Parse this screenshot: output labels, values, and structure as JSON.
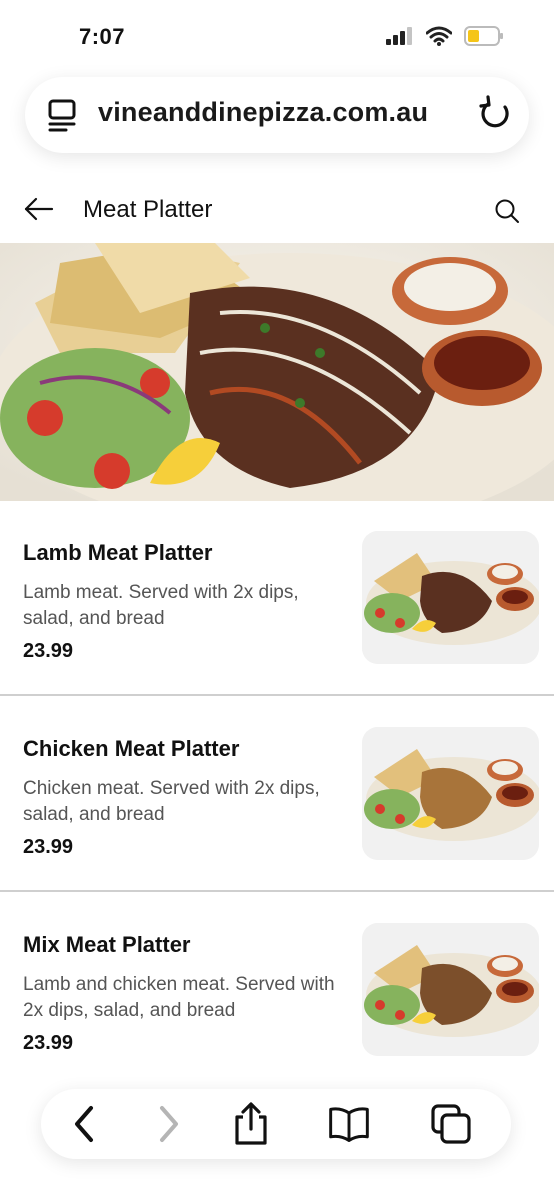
{
  "status": {
    "time": "7:07"
  },
  "browser": {
    "url": "vineanddinepizza.com.au"
  },
  "header": {
    "title": "Meat Platter"
  },
  "items": [
    {
      "name": "Lamb Meat Platter",
      "description": "Lamb meat. Served with 2x dips, salad, and bread",
      "price": "23.99",
      "meat": "#5a3020"
    },
    {
      "name": "Chicken Meat Platter",
      "description": "Chicken meat. Served with 2x dips, salad, and bread",
      "price": "23.99",
      "meat": "#a8743a"
    },
    {
      "name": "Mix Meat Platter",
      "description": "Lamb and chicken meat. Served with 2x dips, salad, and bread",
      "price": "23.99",
      "meat": "#7c4f2b"
    }
  ],
  "icons": {
    "site": "site-tabs-icon",
    "reload": "reload-icon",
    "back": "back-arrow-icon",
    "search": "search-icon",
    "nav_back": "chevron-left-icon",
    "nav_forward": "chevron-right-icon",
    "share": "share-icon",
    "bookmarks": "book-icon",
    "tabs": "tabs-icon"
  },
  "colors": {
    "accent": "#111111",
    "battery": "#f5c518"
  }
}
